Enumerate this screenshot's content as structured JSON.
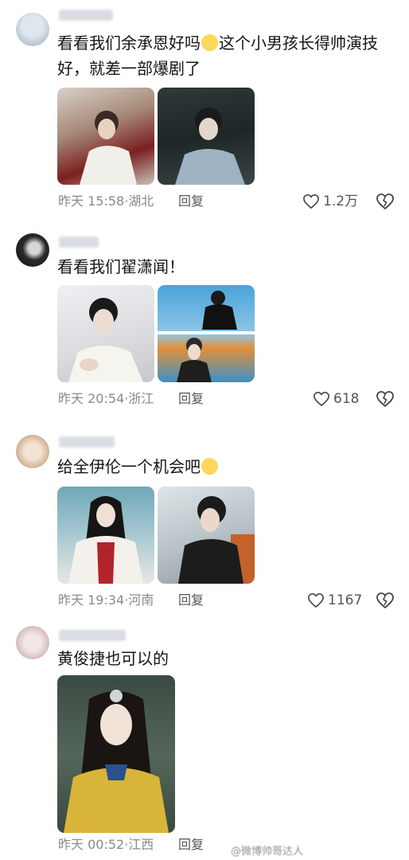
{
  "comments": [
    {
      "text": "看看我们余承恩好吗😭这个小男孩长得帅演技好，就差一部爆剧了",
      "text_before_emoji": "看看我们余承恩好吗",
      "emoji": "😭",
      "text_after_emoji": "这个小男孩长得帅演技好，就差一部爆剧了",
      "time": "昨天 15:58",
      "location": "湖北",
      "reply": "回复",
      "likes": "1.2万"
    },
    {
      "text": "看看我们翟潇闻！",
      "time": "昨天 20:54",
      "location": "浙江",
      "reply": "回复",
      "likes": "618"
    },
    {
      "text_before_emoji": "给全伊伦一个机会吧",
      "emoji": "🥺",
      "time": "昨天 19:34",
      "location": "河南",
      "reply": "回复",
      "likes": "1167"
    },
    {
      "text": "黄俊捷也可以的",
      "time": "昨天 00:52",
      "location": "江西",
      "reply": "回复"
    }
  ],
  "watermark": "@微博帅哥达人",
  "colors": {
    "meta_text": "#8a8a8a",
    "body_text": "#151515",
    "emoji_fill": "#f6c33d"
  },
  "icons": [
    "heart-outline-icon",
    "broken-heart-icon"
  ]
}
